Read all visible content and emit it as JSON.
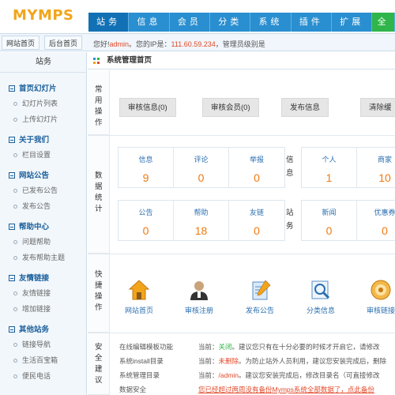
{
  "header": {
    "logo": "MYMPS",
    "nav": [
      "站务",
      "信息",
      "会员",
      "分类",
      "系统",
      "插件",
      "扩展",
      "全"
    ]
  },
  "subbar": {
    "home_btn": "网站首页",
    "admin_home_btn": "后台首页",
    "welcome_prefix": "您好!",
    "username": "admin",
    "ip_prefix": "。您的IP是：",
    "ip": "111.60.59.234",
    "role": "，管理员级别是"
  },
  "sidebar": {
    "title": "站务",
    "groups": [
      {
        "label": "首页幻灯片",
        "items": [
          "幻灯片列表",
          "上传幻灯片"
        ]
      },
      {
        "label": "关于我们",
        "items": [
          "栏目设置"
        ]
      },
      {
        "label": "网站公告",
        "items": [
          "已发布公告",
          "发布公告"
        ]
      },
      {
        "label": "帮助中心",
        "items": [
          "问题帮助",
          "发布帮助主题"
        ]
      },
      {
        "label": "友情链接",
        "items": [
          "友情链接",
          "增加链接"
        ]
      },
      {
        "label": "其他站务",
        "items": [
          "链接导航",
          "生活百宝箱",
          "便民电话"
        ]
      }
    ]
  },
  "main": {
    "title": "系统管理首页",
    "quick_label": "常用操作",
    "quick_buttons": [
      "审核信息(0)",
      "审核会员(0)",
      "发布信息",
      "清除缓"
    ],
    "stats_label": "数据统计",
    "info_label": "信息",
    "site_label": "站务",
    "stats_info": [
      {
        "label": "信息",
        "value": "9"
      },
      {
        "label": "评论",
        "value": "0"
      },
      {
        "label": "举报",
        "value": "0"
      }
    ],
    "stats_site": [
      {
        "label": "公告",
        "value": "0"
      },
      {
        "label": "帮助",
        "value": "18"
      },
      {
        "label": "友链",
        "value": "0"
      }
    ],
    "stats_member": [
      {
        "label": "个人",
        "value": "1"
      },
      {
        "label": "商家",
        "value": "10"
      }
    ],
    "stats_other": [
      {
        "label": "新闻",
        "value": "0"
      },
      {
        "label": "优惠券",
        "value": "0"
      }
    ],
    "shortcut_label": "快捷操作",
    "shortcuts": [
      {
        "label": "网站首页",
        "icon": "home-icon"
      },
      {
        "label": "审核注册",
        "icon": "user-icon"
      },
      {
        "label": "发布公告",
        "icon": "announce-icon"
      },
      {
        "label": "分类信息",
        "icon": "search-doc-icon"
      },
      {
        "label": "审核链接",
        "icon": "link-icon"
      }
    ],
    "security_label": "安全建议",
    "security": [
      {
        "name": "在线编辑模板功能",
        "prefix": "当前：",
        "status": "关闭",
        "status_color": "green",
        "note": "。建议您只有在十分必要的时候才开启它，请修改"
      },
      {
        "name": "系统install目录",
        "prefix": "当前：",
        "status": "未删除",
        "status_color": "red",
        "note": "。为防止站外人员利用，建议您安装完成后，删除"
      },
      {
        "name": "系统管理目录",
        "prefix": "当前：",
        "status": "/admin",
        "status_color": "red",
        "note": "。建议您安装完成后，修改目录名（可直接修改"
      },
      {
        "name": "数据安全",
        "prefix": "",
        "status": "您已经超过两周没有备份Mymps系统全部数据了，点此备份",
        "status_color": "red",
        "note": ""
      }
    ]
  },
  "colors": {
    "nav_bg": "#2a8fd0",
    "nav_active": "#1271b5",
    "logo": "#f2a51a",
    "stat_value": "#f07a10",
    "link": "#2a6fb0"
  }
}
